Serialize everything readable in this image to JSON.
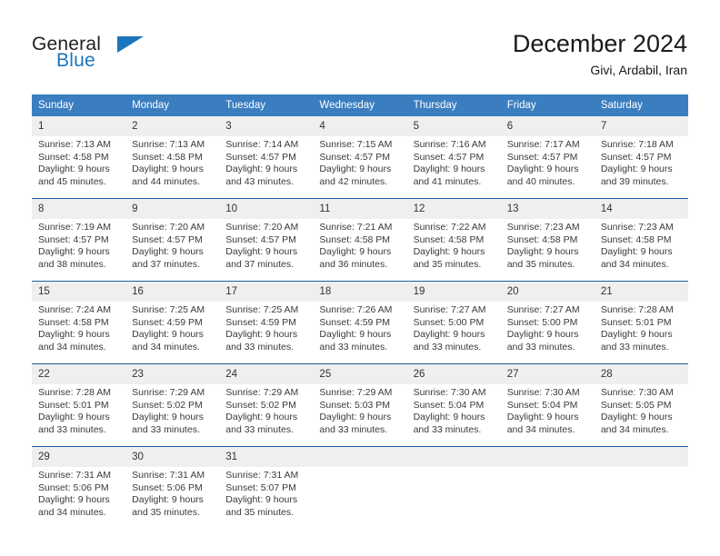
{
  "brand": {
    "name_part1": "General",
    "name_part2": "Blue",
    "triangle_icon": "triangle-icon",
    "color_dark": "#231f20",
    "color_blue": "#1a76bc"
  },
  "header": {
    "title": "December 2024",
    "subtitle": "Givi, Ardabil, Iran"
  },
  "calendar": {
    "header_bg": "#3a7ec0",
    "row_divider": "#1a5fa0",
    "daynum_bg": "#efefef",
    "weekdays": [
      "Sunday",
      "Monday",
      "Tuesday",
      "Wednesday",
      "Thursday",
      "Friday",
      "Saturday"
    ],
    "weeks": [
      [
        {
          "day": "1",
          "sunrise": "Sunrise: 7:13 AM",
          "sunset": "Sunset: 4:58 PM",
          "daylight_line1": "Daylight: 9 hours",
          "daylight_line2": "and 45 minutes."
        },
        {
          "day": "2",
          "sunrise": "Sunrise: 7:13 AM",
          "sunset": "Sunset: 4:58 PM",
          "daylight_line1": "Daylight: 9 hours",
          "daylight_line2": "and 44 minutes."
        },
        {
          "day": "3",
          "sunrise": "Sunrise: 7:14 AM",
          "sunset": "Sunset: 4:57 PM",
          "daylight_line1": "Daylight: 9 hours",
          "daylight_line2": "and 43 minutes."
        },
        {
          "day": "4",
          "sunrise": "Sunrise: 7:15 AM",
          "sunset": "Sunset: 4:57 PM",
          "daylight_line1": "Daylight: 9 hours",
          "daylight_line2": "and 42 minutes."
        },
        {
          "day": "5",
          "sunrise": "Sunrise: 7:16 AM",
          "sunset": "Sunset: 4:57 PM",
          "daylight_line1": "Daylight: 9 hours",
          "daylight_line2": "and 41 minutes."
        },
        {
          "day": "6",
          "sunrise": "Sunrise: 7:17 AM",
          "sunset": "Sunset: 4:57 PM",
          "daylight_line1": "Daylight: 9 hours",
          "daylight_line2": "and 40 minutes."
        },
        {
          "day": "7",
          "sunrise": "Sunrise: 7:18 AM",
          "sunset": "Sunset: 4:57 PM",
          "daylight_line1": "Daylight: 9 hours",
          "daylight_line2": "and 39 minutes."
        }
      ],
      [
        {
          "day": "8",
          "sunrise": "Sunrise: 7:19 AM",
          "sunset": "Sunset: 4:57 PM",
          "daylight_line1": "Daylight: 9 hours",
          "daylight_line2": "and 38 minutes."
        },
        {
          "day": "9",
          "sunrise": "Sunrise: 7:20 AM",
          "sunset": "Sunset: 4:57 PM",
          "daylight_line1": "Daylight: 9 hours",
          "daylight_line2": "and 37 minutes."
        },
        {
          "day": "10",
          "sunrise": "Sunrise: 7:20 AM",
          "sunset": "Sunset: 4:57 PM",
          "daylight_line1": "Daylight: 9 hours",
          "daylight_line2": "and 37 minutes."
        },
        {
          "day": "11",
          "sunrise": "Sunrise: 7:21 AM",
          "sunset": "Sunset: 4:58 PM",
          "daylight_line1": "Daylight: 9 hours",
          "daylight_line2": "and 36 minutes."
        },
        {
          "day": "12",
          "sunrise": "Sunrise: 7:22 AM",
          "sunset": "Sunset: 4:58 PM",
          "daylight_line1": "Daylight: 9 hours",
          "daylight_line2": "and 35 minutes."
        },
        {
          "day": "13",
          "sunrise": "Sunrise: 7:23 AM",
          "sunset": "Sunset: 4:58 PM",
          "daylight_line1": "Daylight: 9 hours",
          "daylight_line2": "and 35 minutes."
        },
        {
          "day": "14",
          "sunrise": "Sunrise: 7:23 AM",
          "sunset": "Sunset: 4:58 PM",
          "daylight_line1": "Daylight: 9 hours",
          "daylight_line2": "and 34 minutes."
        }
      ],
      [
        {
          "day": "15",
          "sunrise": "Sunrise: 7:24 AM",
          "sunset": "Sunset: 4:58 PM",
          "daylight_line1": "Daylight: 9 hours",
          "daylight_line2": "and 34 minutes."
        },
        {
          "day": "16",
          "sunrise": "Sunrise: 7:25 AM",
          "sunset": "Sunset: 4:59 PM",
          "daylight_line1": "Daylight: 9 hours",
          "daylight_line2": "and 34 minutes."
        },
        {
          "day": "17",
          "sunrise": "Sunrise: 7:25 AM",
          "sunset": "Sunset: 4:59 PM",
          "daylight_line1": "Daylight: 9 hours",
          "daylight_line2": "and 33 minutes."
        },
        {
          "day": "18",
          "sunrise": "Sunrise: 7:26 AM",
          "sunset": "Sunset: 4:59 PM",
          "daylight_line1": "Daylight: 9 hours",
          "daylight_line2": "and 33 minutes."
        },
        {
          "day": "19",
          "sunrise": "Sunrise: 7:27 AM",
          "sunset": "Sunset: 5:00 PM",
          "daylight_line1": "Daylight: 9 hours",
          "daylight_line2": "and 33 minutes."
        },
        {
          "day": "20",
          "sunrise": "Sunrise: 7:27 AM",
          "sunset": "Sunset: 5:00 PM",
          "daylight_line1": "Daylight: 9 hours",
          "daylight_line2": "and 33 minutes."
        },
        {
          "day": "21",
          "sunrise": "Sunrise: 7:28 AM",
          "sunset": "Sunset: 5:01 PM",
          "daylight_line1": "Daylight: 9 hours",
          "daylight_line2": "and 33 minutes."
        }
      ],
      [
        {
          "day": "22",
          "sunrise": "Sunrise: 7:28 AM",
          "sunset": "Sunset: 5:01 PM",
          "daylight_line1": "Daylight: 9 hours",
          "daylight_line2": "and 33 minutes."
        },
        {
          "day": "23",
          "sunrise": "Sunrise: 7:29 AM",
          "sunset": "Sunset: 5:02 PM",
          "daylight_line1": "Daylight: 9 hours",
          "daylight_line2": "and 33 minutes."
        },
        {
          "day": "24",
          "sunrise": "Sunrise: 7:29 AM",
          "sunset": "Sunset: 5:02 PM",
          "daylight_line1": "Daylight: 9 hours",
          "daylight_line2": "and 33 minutes."
        },
        {
          "day": "25",
          "sunrise": "Sunrise: 7:29 AM",
          "sunset": "Sunset: 5:03 PM",
          "daylight_line1": "Daylight: 9 hours",
          "daylight_line2": "and 33 minutes."
        },
        {
          "day": "26",
          "sunrise": "Sunrise: 7:30 AM",
          "sunset": "Sunset: 5:04 PM",
          "daylight_line1": "Daylight: 9 hours",
          "daylight_line2": "and 33 minutes."
        },
        {
          "day": "27",
          "sunrise": "Sunrise: 7:30 AM",
          "sunset": "Sunset: 5:04 PM",
          "daylight_line1": "Daylight: 9 hours",
          "daylight_line2": "and 34 minutes."
        },
        {
          "day": "28",
          "sunrise": "Sunrise: 7:30 AM",
          "sunset": "Sunset: 5:05 PM",
          "daylight_line1": "Daylight: 9 hours",
          "daylight_line2": "and 34 minutes."
        }
      ],
      [
        {
          "day": "29",
          "sunrise": "Sunrise: 7:31 AM",
          "sunset": "Sunset: 5:06 PM",
          "daylight_line1": "Daylight: 9 hours",
          "daylight_line2": "and 34 minutes."
        },
        {
          "day": "30",
          "sunrise": "Sunrise: 7:31 AM",
          "sunset": "Sunset: 5:06 PM",
          "daylight_line1": "Daylight: 9 hours",
          "daylight_line2": "and 35 minutes."
        },
        {
          "day": "31",
          "sunrise": "Sunrise: 7:31 AM",
          "sunset": "Sunset: 5:07 PM",
          "daylight_line1": "Daylight: 9 hours",
          "daylight_line2": "and 35 minutes."
        },
        {
          "day": "",
          "sunrise": "",
          "sunset": "",
          "daylight_line1": "",
          "daylight_line2": ""
        },
        {
          "day": "",
          "sunrise": "",
          "sunset": "",
          "daylight_line1": "",
          "daylight_line2": ""
        },
        {
          "day": "",
          "sunrise": "",
          "sunset": "",
          "daylight_line1": "",
          "daylight_line2": ""
        },
        {
          "day": "",
          "sunrise": "",
          "sunset": "",
          "daylight_line1": "",
          "daylight_line2": ""
        }
      ]
    ]
  }
}
